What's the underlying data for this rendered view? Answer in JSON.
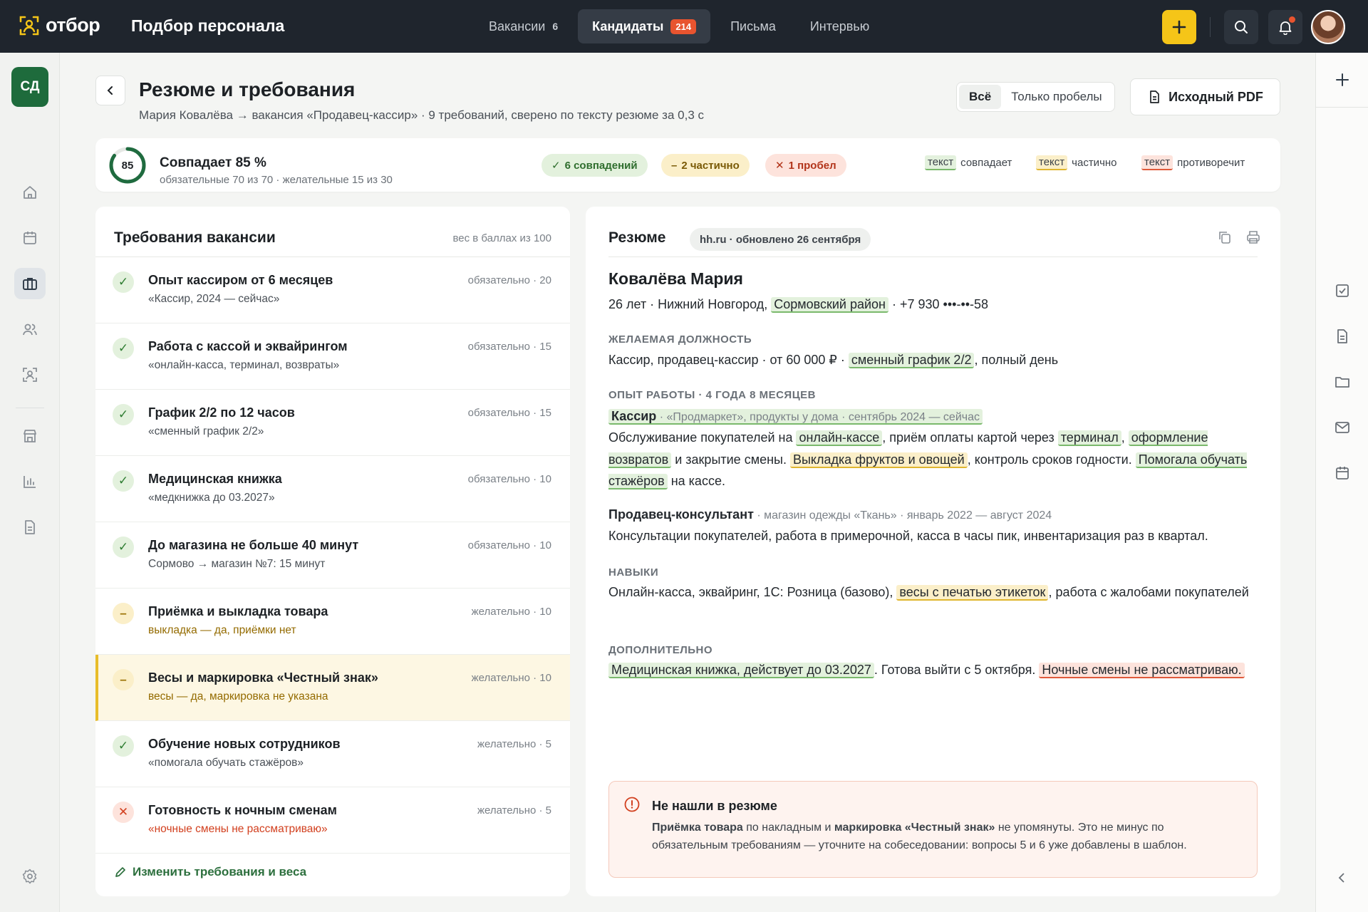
{
  "topbar": {
    "brand": "отбор",
    "app_title": "Подбор персонала",
    "nav": [
      {
        "label": "Вакансии",
        "count": "6"
      },
      {
        "label": "Кандидаты",
        "badge": "214"
      },
      {
        "label": "Письма"
      },
      {
        "label": "Интервью"
      }
    ],
    "icons": [
      "plus-icon",
      "search-icon",
      "bell-icon",
      "avatar"
    ],
    "accent": "#f5c518"
  },
  "user": {
    "initials": "СД"
  },
  "left_rail_icons": [
    "home-icon",
    "calendar-icon",
    "briefcase-icon",
    "users-icon",
    "candidate-scan-icon",
    "store-icon",
    "chart-icon",
    "document-icon",
    "settings-icon"
  ],
  "right_rail_icons": [
    "plus-icon",
    "checkbox-icon",
    "document-icon",
    "folder-icon",
    "mail-icon",
    "calendar-icon",
    "collapse-icon"
  ],
  "header": {
    "title": "Резюме и требования",
    "subtitle": "Мария Ковалёва → вакансия «Продавец-кассир» · 9 требований, сверено по тексту резюме за 0,3 с",
    "filter": {
      "options": [
        "Всё",
        "Только пробелы"
      ],
      "selected": "Всё"
    },
    "pdf_button": "Исходный PDF"
  },
  "match": {
    "score": 85,
    "title": "Совпадает 85 %",
    "subtitle": "обязательные 70 из 70 · желательные 15 из 30",
    "chips": {
      "ok": "6 совпадений",
      "partial": "2 частично",
      "gap": "1 пробел"
    },
    "legend": {
      "sample": "текст",
      "ok": "совпадает",
      "partial": "частично",
      "bad": "противоречит"
    },
    "colors": {
      "ok": "#7ab96c",
      "partial": "#e0b62f",
      "bad": "#e05a3b"
    }
  },
  "requirements": {
    "title": "Требования вакансии",
    "hint": "вес в баллах из 100",
    "edit_link": "Изменить требования и веса",
    "items": [
      {
        "status": "ok",
        "title": "Опыт кассиром от 6 месяцев",
        "note": "«Кассир, 2024 — сейчас»",
        "meta": "обязательно · 20"
      },
      {
        "status": "ok",
        "title": "Работа с кассой и эквайрингом",
        "note": "«онлайн-касса, терминал, возвраты»",
        "meta": "обязательно · 15"
      },
      {
        "status": "ok",
        "title": "График 2/2 по 12 часов",
        "note": "«сменный график 2/2»",
        "meta": "обязательно · 15"
      },
      {
        "status": "ok",
        "title": "Медицинская книжка",
        "note": "«медкнижка до 03.2027»",
        "meta": "обязательно · 10"
      },
      {
        "status": "ok",
        "title": "До магазина не больше 40 минут",
        "note": "Сормово → магазин №7: 15 минут",
        "meta": "обязательно · 10"
      },
      {
        "status": "part",
        "title": "Приёмка и выкладка товара",
        "note": "выкладка — да, приёмки нет",
        "meta": "желательно · 10"
      },
      {
        "status": "part",
        "title": "Весы и маркировка «Честный знак»",
        "note": "весы — да, маркировка не указана",
        "meta": "желательно · 10",
        "selected": true
      },
      {
        "status": "ok",
        "title": "Обучение новых сотрудников",
        "note": "«помогала обучать стажёров»",
        "meta": "желательно · 5"
      },
      {
        "status": "bad",
        "title": "Готовность к ночным сменам",
        "note": "«ночные смены не рассматриваю»",
        "meta": "желательно · 5"
      }
    ]
  },
  "resume": {
    "title": "Резюме",
    "source": "hh.ru · обновлено 26 сентября",
    "name": "Ковалёва Мария",
    "info_a": "26 лет · Нижний Новгород, ",
    "info_district": "Сормовский район",
    "info_b": " · +7 930 •••-••-58",
    "sec_position": "ЖЕЛАЕМАЯ ДОЛЖНОСТЬ",
    "position_a": "Кассир, продавец-кассир · от 60 000 ₽ · ",
    "position_schedule": "сменный график 2/2",
    "position_b": ", полный день",
    "sec_experience": "ОПЫТ РАБОТЫ · 4 ГОДА 8 МЕСЯЦЕВ",
    "job1_title": "Кассир",
    "job1_meta": " · «Продмаркет», продукты у дома · сентябрь 2024 — сейчас",
    "job1": {
      "t1": "Обслуживание покупателей на ",
      "h1": "онлайн-кассе",
      "t2": ", приём оплаты картой через ",
      "h2": "терминал",
      "t3": ", ",
      "h3": "оформление возвратов",
      "t4": " и закрытие смены. ",
      "h4": "Выкладка фруктов и овощей",
      "t5": ", контроль сроков годности. ",
      "h5": "Помогала обучать стажёров",
      "t6": " на кассе."
    },
    "job2_title": "Продавец-консультант",
    "job2_meta": " · магазин одежды «Ткань» · январь 2022 — август 2024",
    "job2_text": "Консультации покупателей, работа в примерочной, касса в часы пик, инвентаризация раз в квартал.",
    "sec_skills": "НАВЫКИ",
    "skills_a": "Онлайн-касса, эквайринг, 1С: Розница (базово), ",
    "skills_h": "весы с печатью этикеток",
    "skills_b": ", работа с жалобами покупателей",
    "sec_extra": "ДОПОЛНИТЕЛЬНО",
    "extra_h1": "Медицинская книжка, действует до 03.2027",
    "extra_t": ". Готова выйти с 5 октября. ",
    "extra_h2": "Ночные смены не рассматриваю.",
    "alert": {
      "title": "Не нашли в резюме",
      "b1": "Приёмка товара",
      "t1": " по накладным и ",
      "b2": "маркировка «Честный знак»",
      "t2": " не упомянуты. Это не минус по обязательным требованиям — уточните на собеседовании: вопросы 5 и 6 уже добавлены в шаблон."
    }
  }
}
